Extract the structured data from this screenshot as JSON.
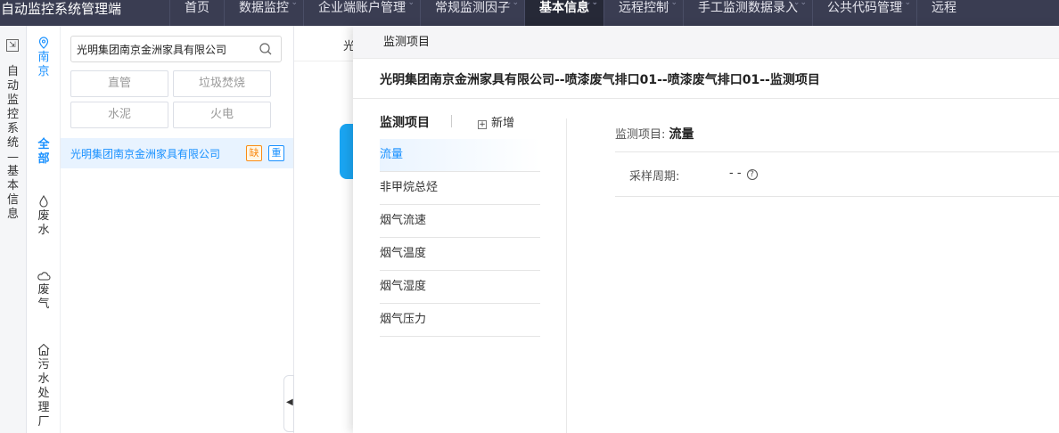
{
  "app": {
    "title": "自动监控系统管理端"
  },
  "nav": [
    {
      "label": "首页",
      "active": false,
      "chev": false
    },
    {
      "label": "数据监控",
      "active": false,
      "chev": true
    },
    {
      "label": "企业端账户管理",
      "active": false,
      "chev": true
    },
    {
      "label": "常规监测因子",
      "active": false,
      "chev": true
    },
    {
      "label": "基本信息",
      "active": true,
      "chev": true
    },
    {
      "label": "远程控制",
      "active": false,
      "chev": true
    },
    {
      "label": "手工监测数据录入",
      "active": false,
      "chev": true
    },
    {
      "label": "公共代码管理",
      "active": false,
      "chev": true
    },
    {
      "label": "远程",
      "active": false,
      "chev": false
    }
  ],
  "rail": {
    "breadcrumb": "自动监控系统—基本信息"
  },
  "categories": {
    "location": "南京",
    "all": "全部",
    "wastewater": "废水",
    "wastegas": "废气",
    "sewage_plant": "污水处理厂"
  },
  "filter": {
    "search_value": "光明集团南京金洲家具有限公司",
    "tags": [
      "直管",
      "垃圾焚烧",
      "水泥",
      "火电"
    ],
    "company": {
      "name": "光明集团南京金洲家具有限公司",
      "badge_missing": "缺",
      "badge_key": "重"
    }
  },
  "background": {
    "tab_label": "光"
  },
  "drawer": {
    "header": "监测项目",
    "title": "光明集团南京金洲家具有限公司--喷漆废气排口01--喷漆废气排口01--监测项目",
    "list_title": "监测项目",
    "add_label": "新增",
    "items": [
      "流量",
      "非甲烷总烃",
      "烟气流速",
      "烟气温度",
      "烟气湿度",
      "烟气压力"
    ],
    "selected_index": 0,
    "detail": {
      "item_label": "监测项目:",
      "item_value": "流量",
      "sample_label": "采样周期:",
      "sample_value": "- -"
    }
  }
}
